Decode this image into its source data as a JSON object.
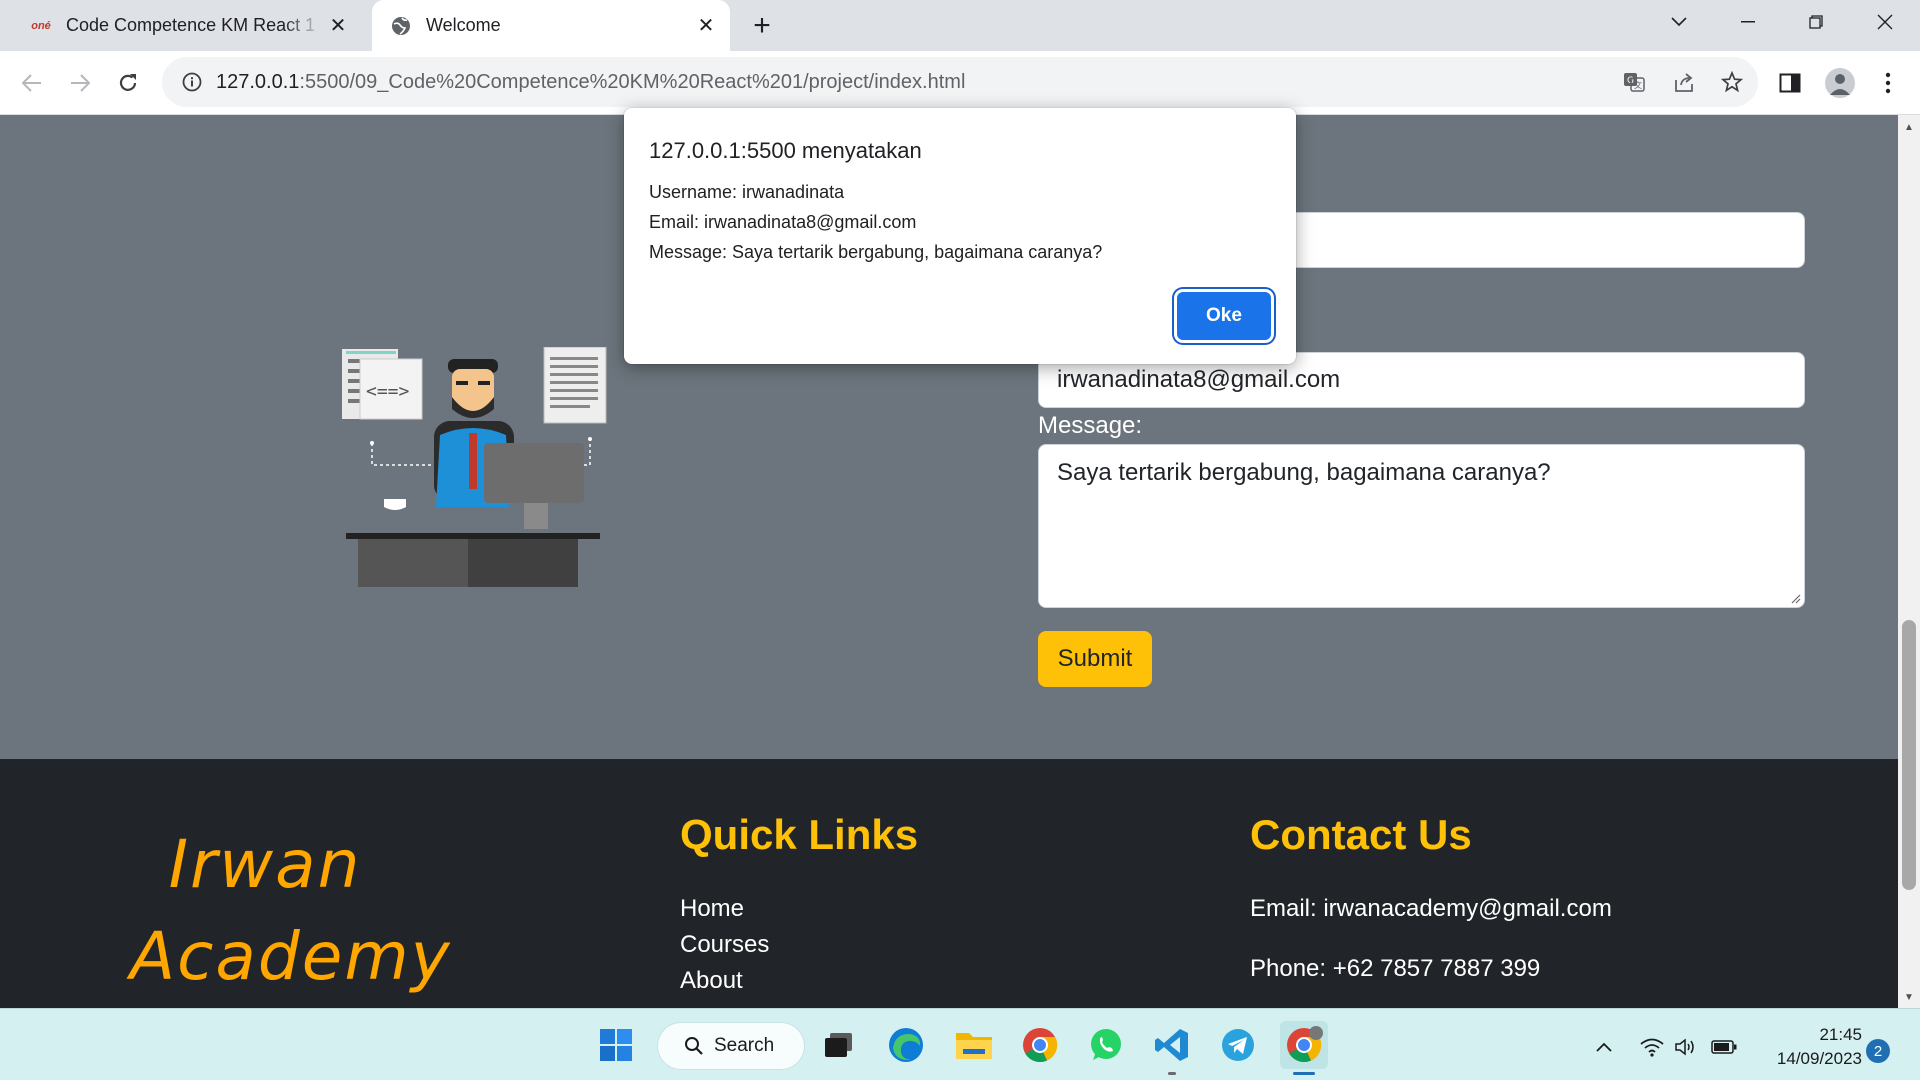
{
  "browser": {
    "tabs": [
      {
        "favicon_text": "oné",
        "title": "Code Competence KM React 1 -",
        "active": false
      },
      {
        "title": "Welcome",
        "active": true
      }
    ],
    "url_host": "127.0.0.1",
    "url_path": ":5500/09_Code%20Competence%20KM%20React%201/project/index.html"
  },
  "form": {
    "email_value": "irwanadinata8@gmail.com",
    "message_label": "Message:",
    "message_value": "Saya tertarik bergabung, bagaimana caranya?",
    "submit_label": "Submit"
  },
  "footer": {
    "brand_line1": "Irwan",
    "brand_line2": "Academy",
    "quick_links_heading": "Quick Links",
    "links": [
      "Home",
      "Courses",
      "About"
    ],
    "contact_heading": "Contact Us",
    "email": "Email: irwanacademy@gmail.com",
    "phone": "Phone: +62 7857 7887 399"
  },
  "alert": {
    "title": "127.0.0.1:5500 menyatakan",
    "lines": [
      "Username: irwanadinata",
      "Email: irwanadinata8@gmail.com",
      "Message: Saya tertarik bergabung, bagaimana caranya?"
    ],
    "ok_label": "Oke"
  },
  "taskbar": {
    "search_label": "Search",
    "time": "21:45",
    "date": "14/09/2023",
    "notification_count": "2"
  },
  "colors": {
    "section_bg": "#6c757d",
    "footer_bg": "#212529",
    "accent_yellow": "#ffc107",
    "brand_orange": "#ffa600",
    "dialog_button": "#1a73e8"
  }
}
